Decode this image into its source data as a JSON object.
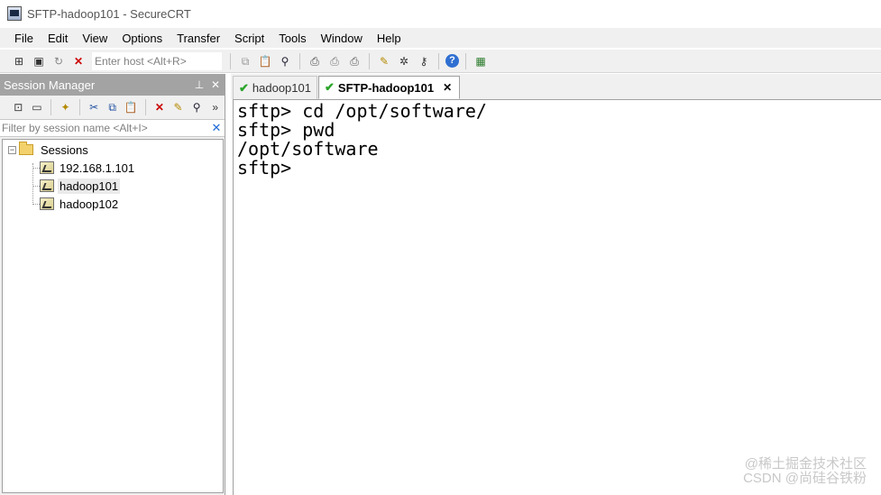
{
  "window": {
    "title": "SFTP-hadoop101 - SecureCRT"
  },
  "menu": [
    "File",
    "Edit",
    "View",
    "Options",
    "Transfer",
    "Script",
    "Tools",
    "Window",
    "Help"
  ],
  "toolbar": {
    "host_placeholder": "Enter host <Alt+R>",
    "left_icons": [
      "connect-icon",
      "quick-connect-icon",
      "reconnect-icon",
      "disconnect-icon"
    ],
    "right_icons": [
      "copy-icon",
      "paste-icon",
      "find-icon",
      "print-setup-icon",
      "print-preview-icon",
      "print-icon",
      "session-options-icon",
      "global-options-icon",
      "keymap-icon",
      "help-icon",
      "sftp-icon"
    ]
  },
  "session_manager": {
    "title": "Session Manager",
    "pin_icon": "pin-icon",
    "filter_placeholder": "Filter by session name <Alt+I>",
    "tree": {
      "root": "Sessions",
      "items": [
        {
          "label": "192.168.1.101",
          "selected": false
        },
        {
          "label": "hadoop101",
          "selected": true
        },
        {
          "label": "hadoop102",
          "selected": false
        }
      ]
    }
  },
  "tabs": [
    {
      "label": "hadoop101",
      "active": false
    },
    {
      "label": "SFTP-hadoop101",
      "active": true
    }
  ],
  "terminal": {
    "lines": [
      "sftp> cd /opt/software/",
      "sftp> pwd",
      "/opt/software",
      "sftp> "
    ]
  },
  "watermark": {
    "line1": "@稀土掘金技术社区",
    "line2": "CSDN @尚硅谷铁粉"
  }
}
